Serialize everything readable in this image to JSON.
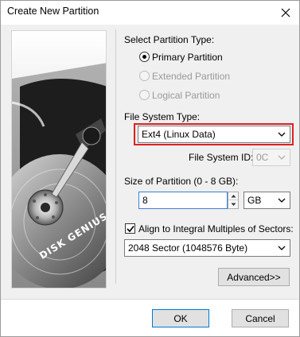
{
  "window": {
    "title": "Create New Partition"
  },
  "brand": {
    "text": "DISK GENIUS"
  },
  "partition_type": {
    "label": "Select Partition Type:",
    "options": [
      {
        "label": "Primary Partition",
        "selected": true,
        "enabled": true
      },
      {
        "label": "Extended Partition",
        "selected": false,
        "enabled": false
      },
      {
        "label": "Logical Partition",
        "selected": false,
        "enabled": false
      }
    ]
  },
  "file_system": {
    "label": "File System Type:",
    "value": "Ext4 (Linux Data)",
    "id_label": "File System ID:",
    "id_value": "0C"
  },
  "size": {
    "label": "Size of Partition (0 - 8 GB):",
    "value": "8",
    "unit": "GB"
  },
  "align": {
    "label": "Align to Integral Multiples of Sectors:",
    "checked": true,
    "value": "2048 Sector (1048576 Byte)"
  },
  "buttons": {
    "advanced": "Advanced>>",
    "ok": "OK",
    "cancel": "Cancel"
  },
  "colors": {
    "highlight": "#e02020",
    "focus": "#0078d7"
  }
}
